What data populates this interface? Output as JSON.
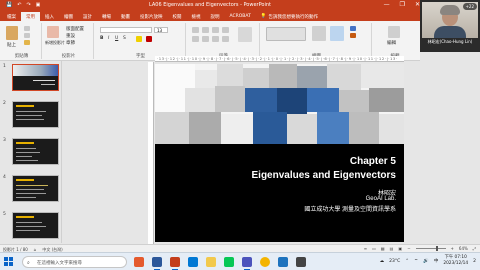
{
  "titlebar": {
    "title": "LA06 Eigenvalues and Eigenvectors  -  PowerPoint",
    "accent": "#c43e1c",
    "quick_access": [
      "💾",
      "↶",
      "↷",
      "▣"
    ],
    "minimize": "—",
    "restore": "❐",
    "close": "✕"
  },
  "menu": {
    "tabs": [
      "檔案",
      "常用",
      "插入",
      "繪圖",
      "設計",
      "轉場",
      "動畫",
      "投影片放映",
      "校閱",
      "檢視",
      "說明",
      "ACROBAT"
    ],
    "active_index": 1,
    "tell_me": "告訴我您想要執行的動作"
  },
  "ribbon": {
    "groups": [
      "剪貼簿",
      "投影片",
      "字型",
      "段落",
      "繪圖",
      "編輯"
    ],
    "paste": "貼上",
    "new_slide": "新增投影片",
    "layout": "版面配置",
    "reset": "重設",
    "section": "章節",
    "editing": "編輯",
    "font_size": "13",
    "font_name": ""
  },
  "speaker": {
    "name": "林昭宏(Chao-Hung Lin)",
    "participants": "+22"
  },
  "ruler": {
    "ticks": "·13·|·12·|·11·|·10·|·9·|·8·|·7·|·6·|·5·|·4·|·3·|·2·|·1·|·0·|·1·|·2·|·3·|·4·|·5·|·6·|·7·|·8·|·9·|·10·|·11·|·12·|·13·"
  },
  "thumbnails": [
    {
      "number": "1"
    },
    {
      "number": "2"
    },
    {
      "number": "3"
    },
    {
      "number": "4"
    },
    {
      "number": "5"
    }
  ],
  "slide": {
    "chapter": "Chapter 5",
    "title": "Eigenvalues and Eigenvectors",
    "author": "林昭宏",
    "lab": "GeoAI Lab.",
    "university": "國立成功大學 測量及空間資訊學系"
  },
  "status": {
    "slide_info": "投影片 1 / 80",
    "language": "中文 (台灣)",
    "zoom": "64%"
  },
  "taskbar": {
    "search_placeholder": "在這裡輸入文字來搜尋",
    "weather": "23°C",
    "time": "下午 07:10",
    "date": "2023/12/14",
    "lang": "中",
    "notification": "2"
  }
}
